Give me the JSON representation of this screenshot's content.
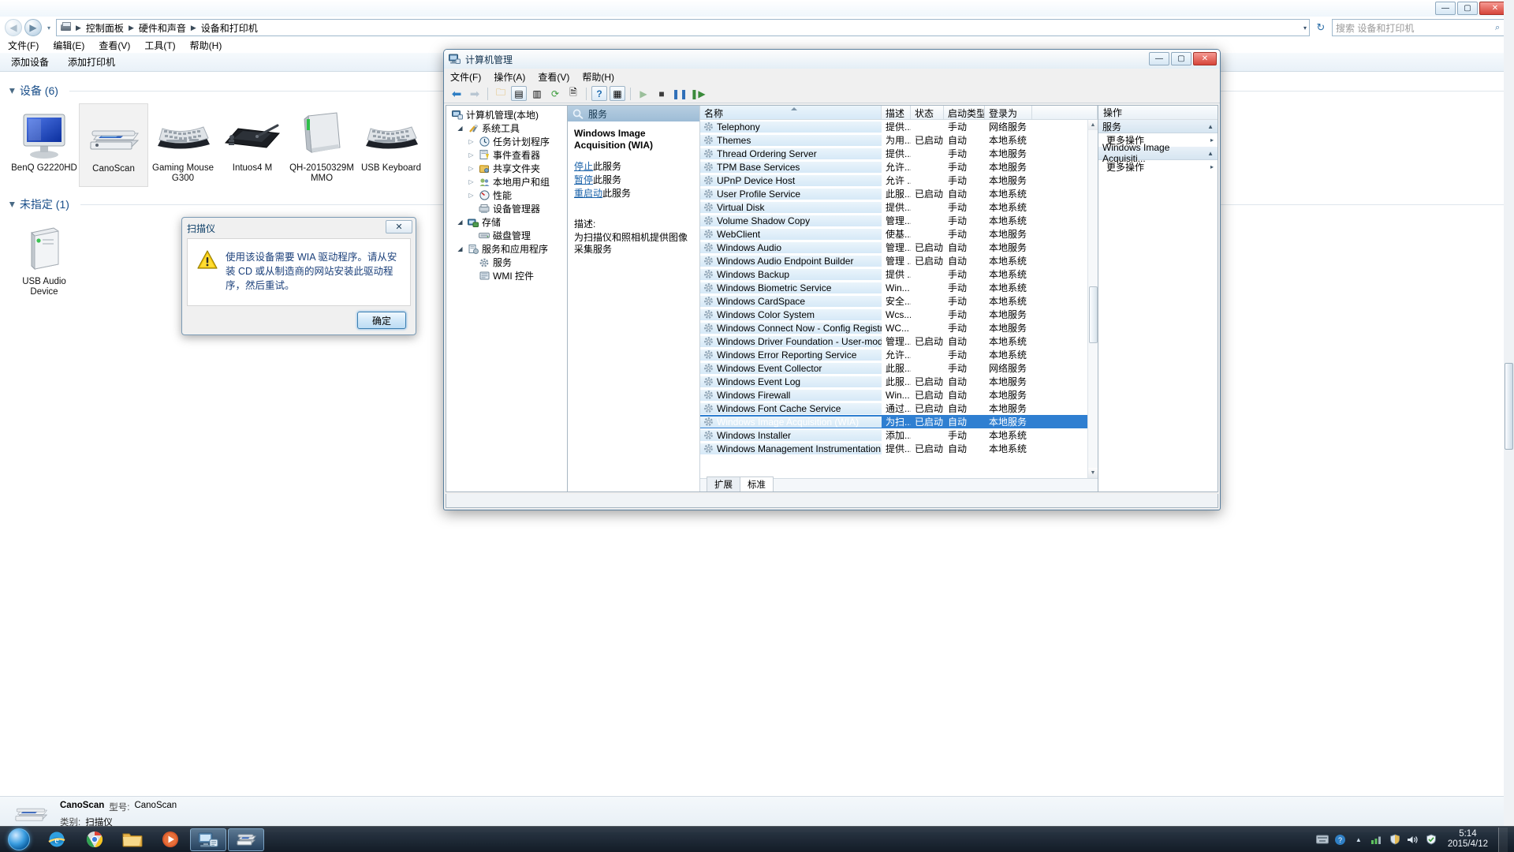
{
  "explorer": {
    "titlebar": {
      "minimize": "—",
      "maximize": "▢",
      "close": "✕"
    },
    "nav": {
      "back": "◀",
      "forward": "▶",
      "dropdown": "▾",
      "refresh": "↻",
      "chevron": "▾"
    },
    "breadcrumb": [
      "控制面板",
      "硬件和声音",
      "设备和打印机"
    ],
    "search": {
      "placeholder": "搜索 设备和打印机",
      "icon": "search-icon"
    },
    "menu": [
      "文件(F)",
      "编辑(E)",
      "查看(V)",
      "工具(T)",
      "帮助(H)"
    ],
    "toolbar": [
      "添加设备",
      "添加打印机"
    ],
    "groups": [
      {
        "title": "设备 (6)",
        "items": [
          {
            "label": "BenQ G2220HD",
            "icon": "monitor-icon",
            "selected": false
          },
          {
            "label": "CanoScan",
            "icon": "scanner-icon",
            "selected": true
          },
          {
            "label": "Gaming Mouse G300",
            "icon": "keyboard-icon",
            "selected": false
          },
          {
            "label": "Intuos4 M",
            "icon": "tablet-icon",
            "selected": false
          },
          {
            "label": "QH-20150329M MMO",
            "icon": "external-drive-icon",
            "selected": false
          },
          {
            "label": "USB Keyboard",
            "icon": "keyboard-icon",
            "selected": false
          }
        ]
      },
      {
        "title": "未指定 (1)",
        "items": [
          {
            "label": "USB Audio Device",
            "icon": "usb-device-icon",
            "selected": false
          }
        ]
      }
    ],
    "status": {
      "title": "CanoScan",
      "model_key": "型号:",
      "model_val": "CanoScan",
      "category_key": "类别:",
      "category_val": "扫描仪"
    }
  },
  "dialog": {
    "title": "扫描仪",
    "close": "✕",
    "icon": "warning-icon",
    "message": "使用该设备需要 WIA 驱动程序。请从安装 CD 或从制造商的网站安装此驱动程序，然后重试。",
    "ok_label": "确定"
  },
  "cmw": {
    "title": "计算机管理",
    "icon": "computer-management-icon",
    "caption": {
      "minimize": "—",
      "maximize": "▢",
      "close": "✕"
    },
    "menu": [
      "文件(F)",
      "操作(A)",
      "查看(V)",
      "帮助(H)"
    ],
    "toolbar_icons": [
      "back-icon",
      "forward-icon",
      "up-folder-icon",
      "show-tree-icon",
      "properties-icon",
      "refresh-icon",
      "export-icon",
      "help-icon",
      "show-pane-icon",
      "start-service-icon",
      "stop-service-icon",
      "pause-service-icon",
      "restart-service-icon"
    ],
    "tree": [
      {
        "label": "计算机管理(本地)",
        "depth": 0,
        "arrow": "none",
        "icon": "computer-icon"
      },
      {
        "label": "系统工具",
        "depth": 1,
        "arrow": "open",
        "icon": "tools-icon"
      },
      {
        "label": "任务计划程序",
        "depth": 2,
        "arrow": "closed",
        "icon": "clock-icon"
      },
      {
        "label": "事件查看器",
        "depth": 2,
        "arrow": "closed",
        "icon": "event-icon"
      },
      {
        "label": "共享文件夹",
        "depth": 2,
        "arrow": "closed",
        "icon": "shared-folder-icon"
      },
      {
        "label": "本地用户和组",
        "depth": 2,
        "arrow": "closed",
        "icon": "users-icon"
      },
      {
        "label": "性能",
        "depth": 2,
        "arrow": "closed",
        "icon": "performance-icon"
      },
      {
        "label": "设备管理器",
        "depth": 2,
        "arrow": "none",
        "icon": "device-manager-icon"
      },
      {
        "label": "存储",
        "depth": 1,
        "arrow": "open",
        "icon": "storage-icon"
      },
      {
        "label": "磁盘管理",
        "depth": 2,
        "arrow": "none",
        "icon": "disk-icon"
      },
      {
        "label": "服务和应用程序",
        "depth": 1,
        "arrow": "open",
        "icon": "services-apps-icon"
      },
      {
        "label": "服务",
        "depth": 2,
        "arrow": "none",
        "icon": "service-icon"
      },
      {
        "label": "WMI 控件",
        "depth": 2,
        "arrow": "none",
        "icon": "wmi-icon"
      }
    ],
    "detail": {
      "header": "服务",
      "header_icon": "service-magnifier-icon",
      "service_name": "Windows Image Acquisition (WIA)",
      "links": [
        {
          "link": "停止",
          "suffix": "此服务"
        },
        {
          "link": "暂停",
          "suffix": "此服务"
        },
        {
          "link": "重启动",
          "suffix": "此服务"
        }
      ],
      "desc_label": "描述:",
      "desc_text": "为扫描仪和照相机提供图像采集服务"
    },
    "columns": [
      "名称",
      "描述",
      "状态",
      "启动类型",
      "登录为"
    ],
    "rows": [
      {
        "name": "Telephony",
        "desc": "提供...",
        "status": "",
        "startup": "手动",
        "logon": "网络服务",
        "selected": false
      },
      {
        "name": "Themes",
        "desc": "为用...",
        "status": "已启动",
        "startup": "自动",
        "logon": "本地系统",
        "selected": false
      },
      {
        "name": "Thread Ordering Server",
        "desc": "提供...",
        "status": "",
        "startup": "手动",
        "logon": "本地服务",
        "selected": false
      },
      {
        "name": "TPM Base Services",
        "desc": "允许...",
        "status": "",
        "startup": "手动",
        "logon": "本地服务",
        "selected": false
      },
      {
        "name": "UPnP Device Host",
        "desc": "允许 ...",
        "status": "",
        "startup": "手动",
        "logon": "本地服务",
        "selected": false
      },
      {
        "name": "User Profile Service",
        "desc": "此服...",
        "status": "已启动",
        "startup": "自动",
        "logon": "本地系统",
        "selected": false
      },
      {
        "name": "Virtual Disk",
        "desc": "提供...",
        "status": "",
        "startup": "手动",
        "logon": "本地系统",
        "selected": false
      },
      {
        "name": "Volume Shadow Copy",
        "desc": "管理...",
        "status": "",
        "startup": "手动",
        "logon": "本地系统",
        "selected": false
      },
      {
        "name": "WebClient",
        "desc": "使基...",
        "status": "",
        "startup": "手动",
        "logon": "本地服务",
        "selected": false
      },
      {
        "name": "Windows Audio",
        "desc": "管理...",
        "status": "已启动",
        "startup": "自动",
        "logon": "本地服务",
        "selected": false
      },
      {
        "name": "Windows Audio Endpoint Builder",
        "desc": "管理 ...",
        "status": "已启动",
        "startup": "自动",
        "logon": "本地系统",
        "selected": false
      },
      {
        "name": "Windows Backup",
        "desc": "提供 ...",
        "status": "",
        "startup": "手动",
        "logon": "本地系统",
        "selected": false
      },
      {
        "name": "Windows Biometric Service",
        "desc": "Win...",
        "status": "",
        "startup": "手动",
        "logon": "本地系统",
        "selected": false
      },
      {
        "name": "Windows CardSpace",
        "desc": "安全...",
        "status": "",
        "startup": "手动",
        "logon": "本地系统",
        "selected": false
      },
      {
        "name": "Windows Color System",
        "desc": "Wcs...",
        "status": "",
        "startup": "手动",
        "logon": "本地服务",
        "selected": false
      },
      {
        "name": "Windows Connect Now - Config Registrar",
        "desc": "WC...",
        "status": "",
        "startup": "手动",
        "logon": "本地服务",
        "selected": false
      },
      {
        "name": "Windows Driver Foundation - User-mode D...",
        "desc": "管理...",
        "status": "已启动",
        "startup": "自动",
        "logon": "本地系统",
        "selected": false
      },
      {
        "name": "Windows Error Reporting Service",
        "desc": "允许...",
        "status": "",
        "startup": "手动",
        "logon": "本地系统",
        "selected": false
      },
      {
        "name": "Windows Event Collector",
        "desc": "此服...",
        "status": "",
        "startup": "手动",
        "logon": "网络服务",
        "selected": false
      },
      {
        "name": "Windows Event Log",
        "desc": "此服...",
        "status": "已启动",
        "startup": "自动",
        "logon": "本地服务",
        "selected": false
      },
      {
        "name": "Windows Firewall",
        "desc": "Win...",
        "status": "已启动",
        "startup": "自动",
        "logon": "本地服务",
        "selected": false
      },
      {
        "name": "Windows Font Cache Service",
        "desc": "通过...",
        "status": "已启动",
        "startup": "自动",
        "logon": "本地服务",
        "selected": false
      },
      {
        "name": "Windows Image Acquisition (WIA)",
        "desc": "为扫...",
        "status": "已启动",
        "startup": "自动",
        "logon": "本地服务",
        "selected": true
      },
      {
        "name": "Windows Installer",
        "desc": "添加...",
        "status": "",
        "startup": "手动",
        "logon": "本地系统",
        "selected": false
      },
      {
        "name": "Windows Management Instrumentation",
        "desc": "提供...",
        "status": "已启动",
        "startup": "自动",
        "logon": "本地系统",
        "selected": false
      }
    ],
    "tabs": [
      {
        "label": "扩展",
        "active": false
      },
      {
        "label": "标准",
        "active": true
      }
    ],
    "actions": {
      "header": "操作",
      "sections": [
        {
          "title": "服务",
          "caret": "▲",
          "items": [
            {
              "label": "更多操作",
              "caret": "▸"
            }
          ]
        },
        {
          "title": "Windows Image Acquisiti...",
          "caret": "▲",
          "items": [
            {
              "label": "更多操作",
              "caret": "▸"
            }
          ]
        }
      ]
    }
  },
  "taskbar": {
    "start_label": "start-orb",
    "items": [
      {
        "name": "internet-explorer",
        "active": false
      },
      {
        "name": "google-chrome",
        "active": false
      },
      {
        "name": "windows-explorer",
        "active": false
      },
      {
        "name": "media-player",
        "active": false
      },
      {
        "name": "computer-management",
        "active": true
      },
      {
        "name": "devices-and-printers",
        "active": true
      }
    ],
    "tray": [
      "keyboard-tray-icon",
      "help-tray-icon",
      "overflow-icon",
      "network-icon",
      "shield-icon",
      "volume-icon",
      "action-center-icon"
    ],
    "clock_time": "5:14",
    "clock_date": "2015/4/12"
  }
}
